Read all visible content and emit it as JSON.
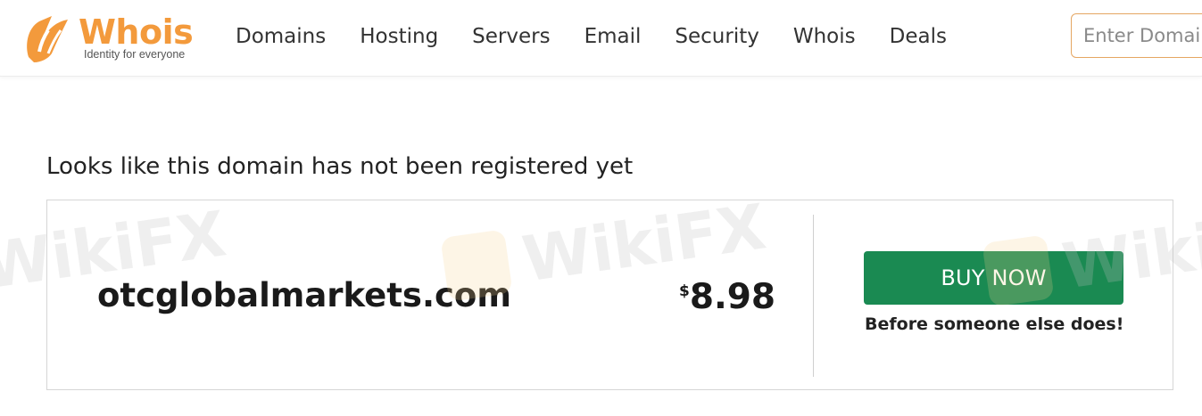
{
  "brand": {
    "name": "Whois",
    "tagline": "Identity for everyone",
    "accent_color": "#f39a3c",
    "logo_icon": "whois-logo-icon"
  },
  "nav": {
    "items": [
      {
        "label": "Domains"
      },
      {
        "label": "Hosting"
      },
      {
        "label": "Servers"
      },
      {
        "label": "Email"
      },
      {
        "label": "Security"
      },
      {
        "label": "Whois"
      },
      {
        "label": "Deals"
      }
    ]
  },
  "search": {
    "placeholder": "Enter Domain"
  },
  "main": {
    "headline": "Looks like this domain has not been registered yet",
    "result": {
      "domain": "otcglobalmarkets.com",
      "currency": "$",
      "price": "8.98",
      "buy_label": "BUY NOW",
      "buy_color": "#1a8a52",
      "subtext": "Before someone else does!"
    }
  },
  "watermark": {
    "text": "WikiFX"
  }
}
